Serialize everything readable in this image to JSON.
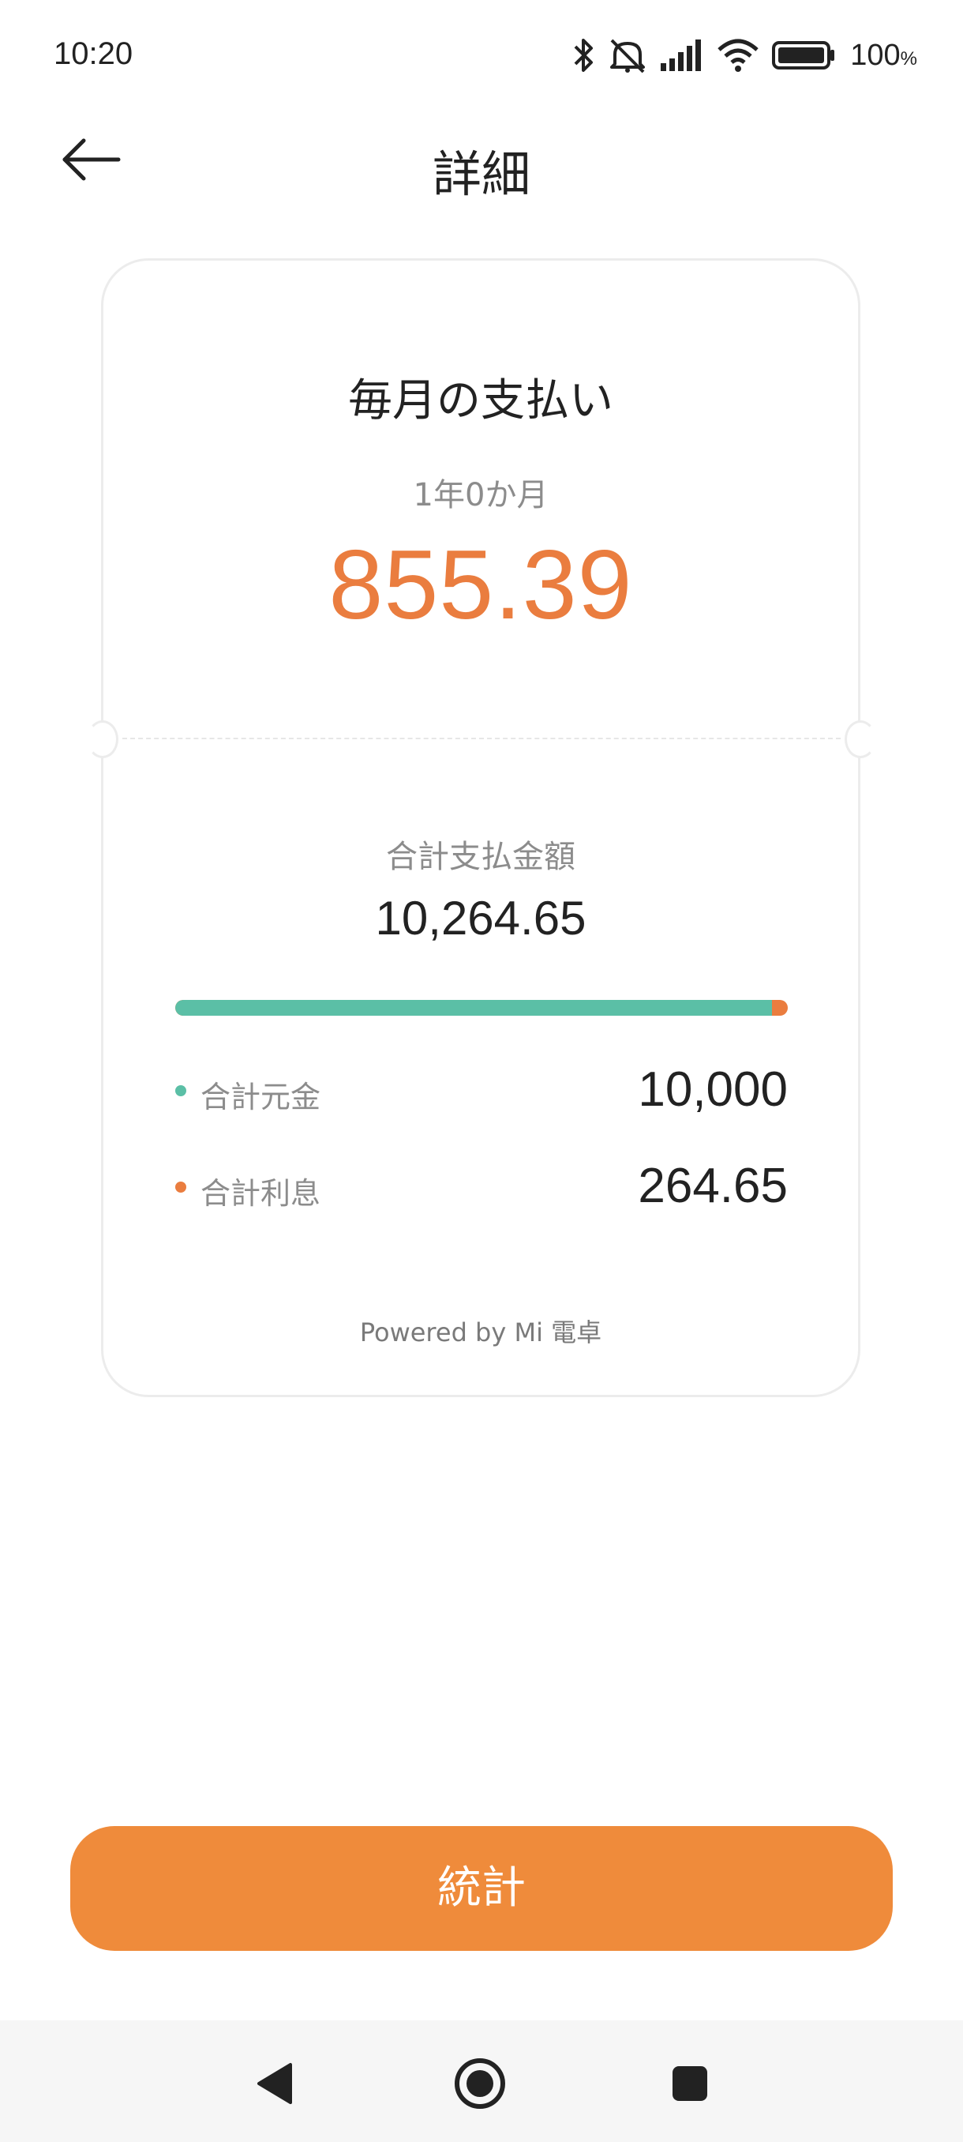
{
  "status_bar": {
    "time": "10:20",
    "battery_percent": "100",
    "battery_unit": "%",
    "icons": [
      "bluetooth-icon",
      "mute-icon",
      "signal-icon",
      "wifi-icon",
      "battery-icon"
    ]
  },
  "header": {
    "title": "詳細",
    "back_icon": "arrow-left-icon"
  },
  "summary": {
    "monthly_label": "毎月の支払い",
    "period": "1年0か月",
    "monthly_amount": "855.39",
    "total_label": "合計支払金額",
    "total_amount": "10,264.65",
    "principal_ratio": 0.974,
    "legend": {
      "principal_label": "合計元金",
      "principal_value": "10,000",
      "interest_label": "合計利息",
      "interest_value": "264.65"
    },
    "powered_by": "Powered by Mi 電卓"
  },
  "colors": {
    "accent": "#ea7d3f",
    "principal": "#5bbfa6",
    "interest": "#ea7d3f",
    "button": "#ef8b3b"
  },
  "actions": {
    "stats_label": "統計"
  },
  "nav": {
    "icons": [
      "nav-back-icon",
      "nav-home-icon",
      "nav-recents-icon"
    ]
  }
}
